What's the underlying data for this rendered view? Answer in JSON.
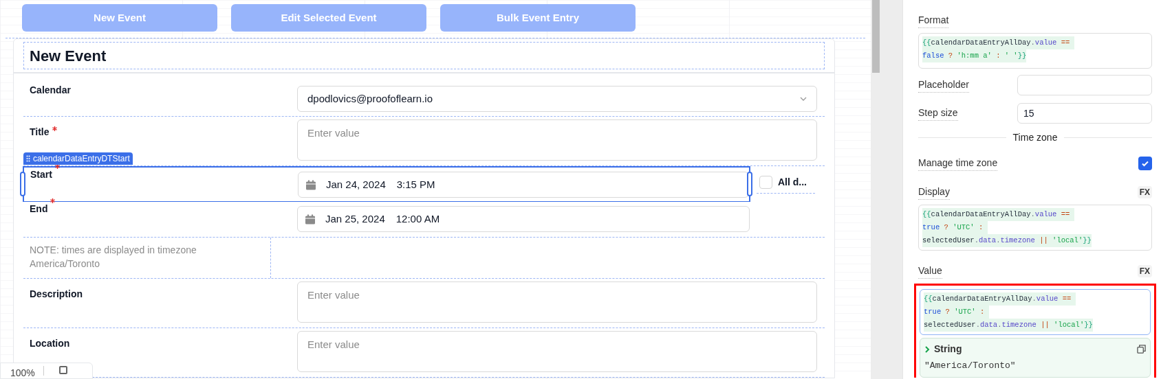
{
  "toolbar": {
    "buttons": [
      {
        "label": "New Event"
      },
      {
        "label": "Edit Selected Event"
      },
      {
        "label": "Bulk Event Entry"
      }
    ]
  },
  "form": {
    "title": "New Event",
    "selection_tag": "calendarDataEntryDTStart",
    "rows": [
      {
        "kind": "select",
        "label": "Calendar",
        "required": false,
        "selected": false,
        "value": "dpodlovics@proofoflearn.io"
      },
      {
        "kind": "textarea",
        "label": "Title",
        "required": true,
        "selected": false,
        "placeholder": "Enter value"
      },
      {
        "kind": "datetime",
        "label": "Start",
        "required": true,
        "selected": true,
        "date": "Jan 24, 2024",
        "time": "3:15 PM",
        "all_day": {
          "label": "All d...",
          "checked": false
        }
      },
      {
        "kind": "datetime",
        "label": "End",
        "required": true,
        "selected": false,
        "date": "Jan 25, 2024",
        "time": "12:00 AM"
      },
      {
        "kind": "note",
        "text": "NOTE: times are displayed in timezone America/Toronto",
        "selected": false
      },
      {
        "kind": "textarea",
        "label": "Description",
        "required": false,
        "selected": false,
        "placeholder": "Enter value"
      },
      {
        "kind": "textarea",
        "label": "Location",
        "required": false,
        "selected": false,
        "placeholder": "Enter value"
      }
    ]
  },
  "zoom_control": {
    "value": "100%"
  },
  "inspector": {
    "format": {
      "label": "Format",
      "code": [
        [
          {
            "kind": "brace",
            "text": "{{"
          },
          {
            "kind": "ident",
            "text": "calendarDataEntryAllDay"
          },
          {
            "kind": "punct",
            "text": "."
          },
          {
            "kind": "prop",
            "text": "value"
          },
          {
            "kind": "op",
            "text": " == "
          }
        ],
        [
          {
            "kind": "keyword",
            "text": "false"
          },
          {
            "kind": "op",
            "text": " ? "
          },
          {
            "kind": "string",
            "text": "'h:mm a'"
          },
          {
            "kind": "op",
            "text": " : "
          },
          {
            "kind": "string",
            "text": "' '"
          },
          {
            "kind": "brace",
            "text": "}}"
          }
        ]
      ]
    },
    "placeholder": {
      "label": "Placeholder"
    },
    "step_size": {
      "label": "Step size",
      "value": "15"
    },
    "section": "Time zone",
    "manage_time_zone": {
      "label": "Manage time zone",
      "checked": true
    },
    "display": {
      "label": "Display",
      "fx": "FX",
      "code": [
        [
          {
            "kind": "brace",
            "text": "{{"
          },
          {
            "kind": "ident",
            "text": "calendarDataEntryAllDay"
          },
          {
            "kind": "punct",
            "text": "."
          },
          {
            "kind": "prop",
            "text": "value"
          },
          {
            "kind": "op",
            "text": " == "
          }
        ],
        [
          {
            "kind": "keyword",
            "text": "true"
          },
          {
            "kind": "op",
            "text": " ? "
          },
          {
            "kind": "string",
            "text": "'UTC'"
          },
          {
            "kind": "op",
            "text": " : "
          }
        ],
        [
          {
            "kind": "ident",
            "text": "selectedUser"
          },
          {
            "kind": "punct",
            "text": "."
          },
          {
            "kind": "prop",
            "text": "data"
          },
          {
            "kind": "punct",
            "text": "."
          },
          {
            "kind": "prop",
            "text": "timezone"
          },
          {
            "kind": "op",
            "text": " || "
          },
          {
            "kind": "string",
            "text": "'local'"
          },
          {
            "kind": "brace",
            "text": "}}"
          }
        ]
      ]
    },
    "value": {
      "label": "Value",
      "fx": "FX",
      "highlighted": true,
      "code": [
        [
          {
            "kind": "brace",
            "text": "{{"
          },
          {
            "kind": "ident",
            "text": "calendarDataEntryAllDay"
          },
          {
            "kind": "punct",
            "text": "."
          },
          {
            "kind": "prop",
            "text": "value"
          },
          {
            "kind": "op",
            "text": " == "
          }
        ],
        [
          {
            "kind": "keyword",
            "text": "true"
          },
          {
            "kind": "op",
            "text": " ? "
          },
          {
            "kind": "string",
            "text": "'UTC'"
          },
          {
            "kind": "op",
            "text": " : "
          }
        ],
        [
          {
            "kind": "ident",
            "text": "selectedUser"
          },
          {
            "kind": "punct",
            "text": "."
          },
          {
            "kind": "prop",
            "text": "data"
          },
          {
            "kind": "punct",
            "text": "."
          },
          {
            "kind": "prop",
            "text": "timezone"
          },
          {
            "kind": "op",
            "text": " || "
          },
          {
            "kind": "string",
            "text": "'local'"
          },
          {
            "kind": "brace",
            "text": "}}"
          }
        ]
      ],
      "result": {
        "type": "String",
        "value": "\"America/Toronto\""
      }
    }
  }
}
